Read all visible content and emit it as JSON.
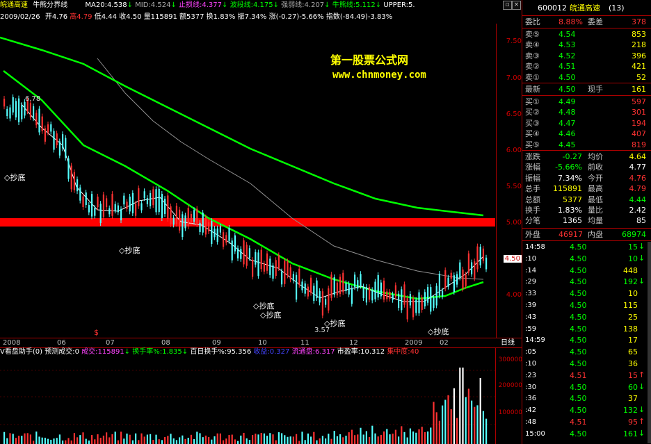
{
  "colors": {
    "up": "#ff3232",
    "down": "#54ffff",
    "ma_green": "#00ff00",
    "ma_white": "#ffffff",
    "ma_gray": "#909090",
    "red_band": "#ff0000",
    "yellow": "#ffff00",
    "magenta": "#ff44ff"
  },
  "header": {
    "stock_name": "皖通高速",
    "indicator_name": "牛熊分界线",
    "ma20": "MA20:4.538",
    "mid": "MID:4.524",
    "stop_loss": "止损线:4.377",
    "wave": "波段线:4.175",
    "strength": "强弱线:4.207",
    "bull": "牛熊线:5.112",
    "upper": "UPPER:5."
  },
  "bar_info": {
    "date": "2009/02/26",
    "open": "开4.76",
    "high": "高4.79",
    "low": "低4.44",
    "close": "收4.50",
    "vol": "量115891",
    "amount": "额5377",
    "turnover": "换1.83%",
    "amplitude": "振7.34%",
    "change": "涨(-0.27)-5.66%",
    "index": "指数(-84.49)-3.83%"
  },
  "watermark": {
    "line1": "第一股票公式网",
    "line2": "www.chnmoney.com"
  },
  "price_axis": {
    "ticks": [
      "7.50",
      "7.00",
      "6.50",
      "6.00",
      "5.50",
      "5.00",
      "4.50",
      "4.00"
    ],
    "current": "4.50"
  },
  "labels": {
    "high": "6.78",
    "low": "3.57",
    "buy": "◇抄底",
    "arrow": "$"
  },
  "x_axis": {
    "labels": [
      "2008",
      "06",
      "07",
      "08",
      "09",
      "10",
      "11",
      "12",
      "2009",
      "02"
    ],
    "right_label": "日线"
  },
  "volume_header": {
    "title": "V看盘助手(0)",
    "predict": "预测成交:0",
    "deal": "成交:115891",
    "turnover": "换手率%:1.835",
    "hundred": "百日换手%:95.356",
    "eps": "收益:0.327",
    "float": "流通盘:6.317",
    "pe": "市盈率:10.312",
    "concentration": "集中度:40"
  },
  "volume_axis": {
    "ticks": [
      "300000",
      "200000",
      "100000"
    ]
  },
  "side": {
    "code": "600012",
    "name": "皖通高速",
    "rank": "(13)",
    "wb_label": "委比",
    "wb_pct": "8.88%",
    "wc_label": "委差",
    "wc_val": "378",
    "sells": [
      {
        "l": "卖⑤",
        "p": "4.54",
        "v": "853"
      },
      {
        "l": "卖④",
        "p": "4.53",
        "v": "218"
      },
      {
        "l": "卖③",
        "p": "4.52",
        "v": "396"
      },
      {
        "l": "卖②",
        "p": "4.51",
        "v": "421"
      },
      {
        "l": "卖①",
        "p": "4.50",
        "v": "52"
      }
    ],
    "last_label": "最新",
    "last": "4.50",
    "cur_label": "现手",
    "cur": "161",
    "buys": [
      {
        "l": "买①",
        "p": "4.49",
        "v": "597"
      },
      {
        "l": "买②",
        "p": "4.48",
        "v": "301"
      },
      {
        "l": "买③",
        "p": "4.47",
        "v": "194"
      },
      {
        "l": "买④",
        "p": "4.46",
        "v": "407"
      },
      {
        "l": "买⑤",
        "p": "4.45",
        "v": "819"
      }
    ],
    "stats": [
      {
        "a": "涨跌",
        "b": "-0.27",
        "c": "均价",
        "d": "4.64"
      },
      {
        "a": "涨幅",
        "b": "-5.66%",
        "c": "前收",
        "d": "4.77"
      },
      {
        "a": "振幅",
        "b": "7.34%",
        "c": "今开",
        "d": "4.76"
      },
      {
        "a": "总手",
        "b": "115891",
        "c": "最高",
        "d": "4.79"
      },
      {
        "a": "总额",
        "b": "5377",
        "c": "最低",
        "d": "4.44"
      },
      {
        "a": "换手",
        "b": "1.83%",
        "c": "量比",
        "d": "2.42"
      },
      {
        "a": "分笔",
        "b": "1365",
        "c": "均量",
        "d": "85"
      }
    ],
    "outer_label": "外盘",
    "outer": "46917",
    "inner_label": "内盘",
    "inner": "68974",
    "ticks": [
      {
        "t": "14:58",
        "p": "4.50",
        "v": "15",
        "d": "down"
      },
      {
        "t": ":10",
        "p": "4.50",
        "v": "10",
        "d": "down"
      },
      {
        "t": ":14",
        "p": "4.50",
        "v": "448",
        "d": ""
      },
      {
        "t": ":29",
        "p": "4.50",
        "v": "192",
        "d": "down"
      },
      {
        "t": ":33",
        "p": "4.50",
        "v": "10",
        "d": ""
      },
      {
        "t": ":39",
        "p": "4.50",
        "v": "115",
        "d": ""
      },
      {
        "t": ":43",
        "p": "4.50",
        "v": "25",
        "d": ""
      },
      {
        "t": ":59",
        "p": "4.50",
        "v": "138",
        "d": ""
      },
      {
        "t": "14:59",
        "p": "4.50",
        "v": "17",
        "d": ""
      },
      {
        "t": ":05",
        "p": "4.50",
        "v": "65",
        "d": ""
      },
      {
        "t": ":10",
        "p": "4.50",
        "v": "36",
        "d": ""
      },
      {
        "t": ":23",
        "p": "4.51",
        "v": "15",
        "d": "up"
      },
      {
        "t": ":30",
        "p": "4.50",
        "v": "60",
        "d": "down"
      },
      {
        "t": ":36",
        "p": "4.50",
        "v": "37",
        "d": ""
      },
      {
        "t": ":42",
        "p": "4.50",
        "v": "132",
        "d": "down"
      },
      {
        "t": ":48",
        "p": "4.51",
        "v": "95",
        "d": "up"
      },
      {
        "t": "15:00",
        "p": "4.50",
        "v": "161",
        "d": "down"
      }
    ]
  }
}
